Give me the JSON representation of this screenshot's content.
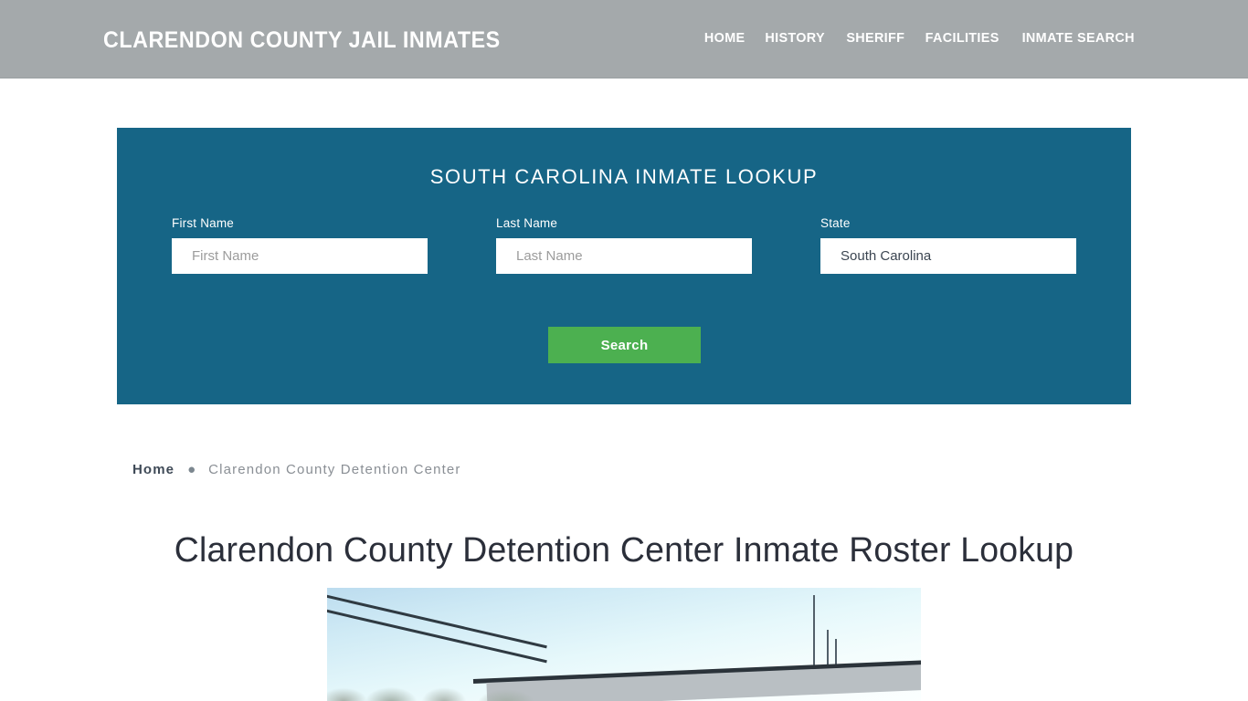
{
  "header": {
    "site_title": "CLARENDON COUNTY JAIL INMATES",
    "bg_color": "#a4a9ab",
    "nav": [
      {
        "label": "HOME"
      },
      {
        "label": "HISTORY"
      },
      {
        "label": "SHERIFF"
      },
      {
        "label": "FACILITIES"
      },
      {
        "label": "INMATE SEARCH"
      }
    ]
  },
  "lookup_panel": {
    "heading": "SOUTH CAROLINA INMATE LOOKUP",
    "bg_color": "#166586",
    "fields": {
      "first_name": {
        "label": "First Name",
        "placeholder": "First Name",
        "value": ""
      },
      "last_name": {
        "label": "Last Name",
        "placeholder": "Last Name",
        "value": ""
      },
      "state": {
        "label": "State",
        "placeholder": "State",
        "value": "South Carolina"
      }
    },
    "search_button": {
      "label": "Search",
      "color": "#4cb050"
    }
  },
  "breadcrumb": {
    "home_label": "Home",
    "separator": "●",
    "current_label": "Clarendon County Detention Center"
  },
  "page": {
    "title": "Clarendon County Detention Center Inmate Roster Lookup",
    "title_color": "#2b2f3a"
  },
  "facility_photo": {
    "alt": "Clarendon County Detention Center building exterior with sky, power lines and antennas"
  }
}
